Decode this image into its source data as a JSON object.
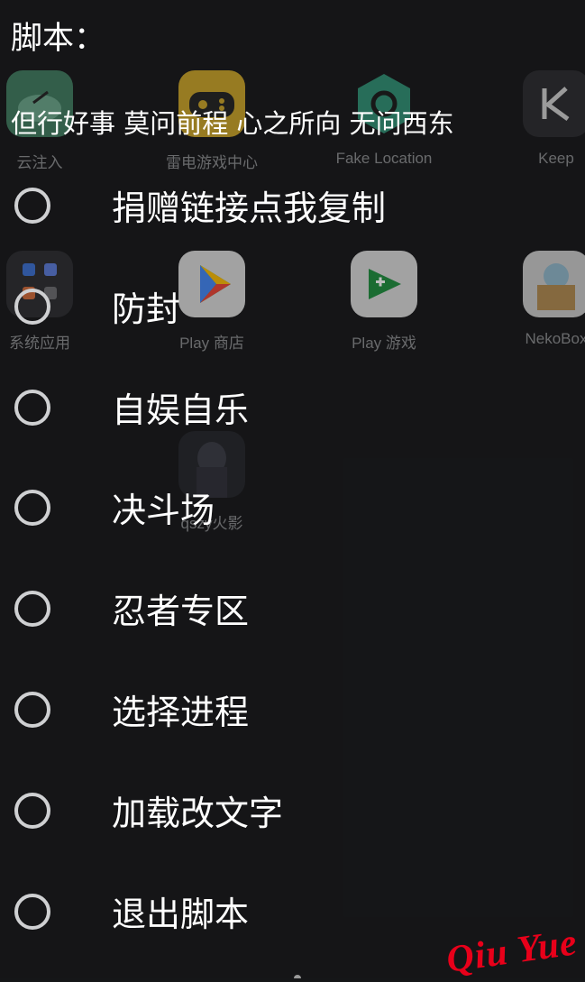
{
  "header": {
    "title": "脚本："
  },
  "subtitle": "但行好事 莫问前程 心之所向 无问西东",
  "options": [
    {
      "label": "捐赠链接点我复制"
    },
    {
      "label": "防封"
    },
    {
      "label": "自娱自乐"
    },
    {
      "label": "决斗场"
    },
    {
      "label": "忍者专区"
    },
    {
      "label": "选择进程"
    },
    {
      "label": "加载改文字"
    },
    {
      "label": "退出脚本"
    }
  ],
  "background_apps": [
    {
      "label": "云注入",
      "icon": "cloud-inject-icon"
    },
    {
      "label": "雷电游戏中心",
      "icon": "gamepad-icon"
    },
    {
      "label": "Fake Location",
      "icon": "location-pin-icon"
    },
    {
      "label": "Keep",
      "icon": "keep-k-icon"
    },
    {
      "label": "系统应用",
      "icon": "system-apps-folder-icon"
    },
    {
      "label": "Play 商店",
      "icon": "play-store-icon"
    },
    {
      "label": "Play 游戏",
      "icon": "play-games-icon"
    },
    {
      "label": "NekoBox",
      "icon": "nekobox-icon"
    },
    {
      "label": "qszy火影",
      "icon": "anime-character-icon"
    }
  ],
  "watermark": "Qiu Yue",
  "colors": {
    "background": "#151618",
    "radio": "#cfd0d2",
    "watermark": "#e8001a"
  }
}
